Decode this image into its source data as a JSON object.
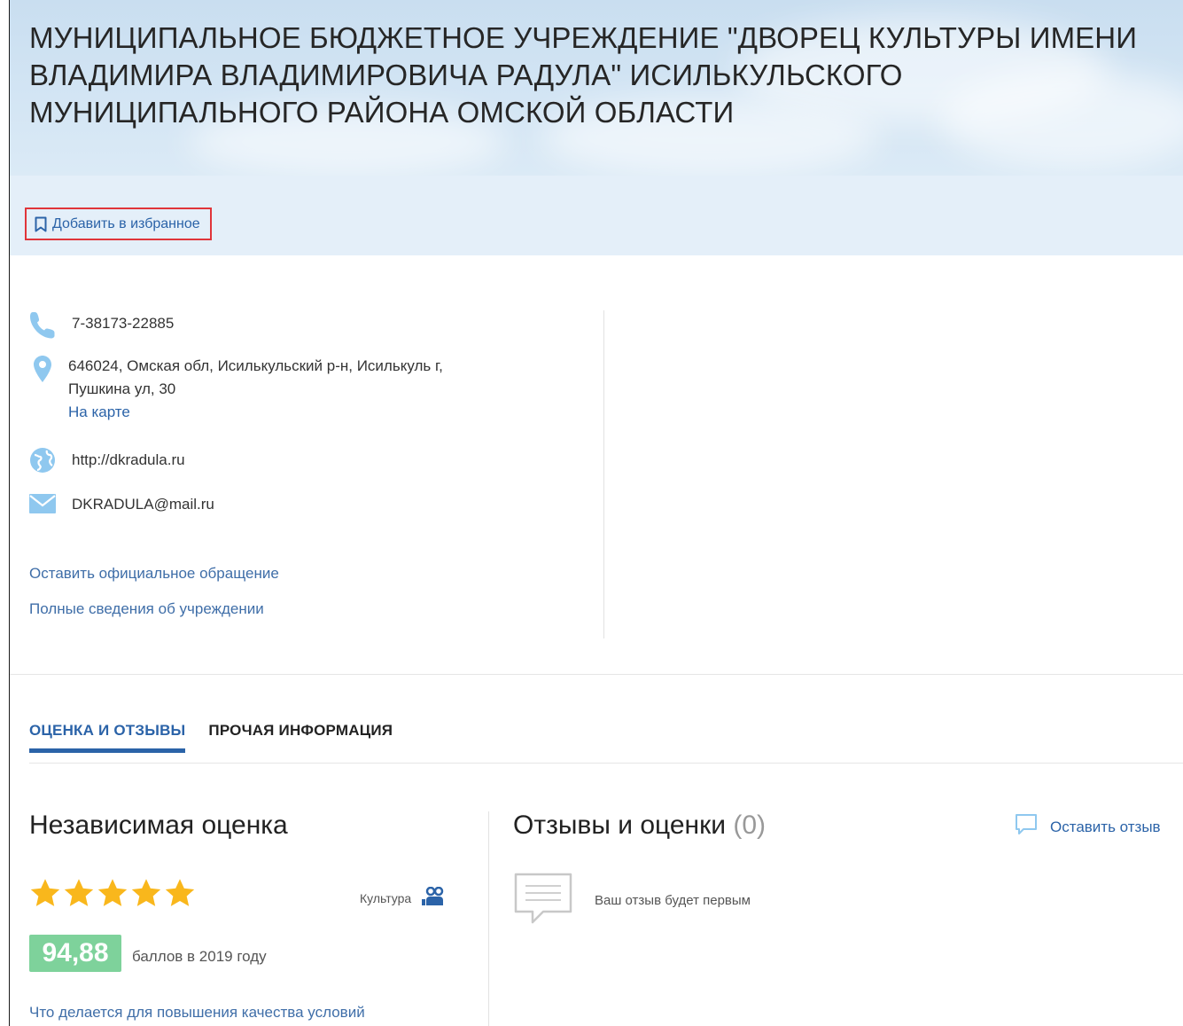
{
  "header": {
    "title": "МУНИЦИПАЛЬНОЕ БЮДЖЕТНОЕ УЧРЕЖДЕНИЕ \"ДВОРЕЦ КУЛЬТУРЫ ИМЕНИ ВЛАДИМИРА ВЛАДИМИРОВИЧА РАДУЛА\" ИСИЛЬКУЛЬСКОГО МУНИЦИПАЛЬНОГО РАЙОНА ОМСКОЙ ОБЛАСТИ",
    "favorite_label": "Добавить в избранное",
    "favorite_icon": "bookmark-icon",
    "highlight_color": "#e0353a"
  },
  "contacts": {
    "phone": "7-38173-22885",
    "address_line1": "646024, Омская обл, Исилькульский р-н, Исилькуль г,",
    "address_line2": "Пушкина ул, 30",
    "map_link": "На карте",
    "website": "http://dkradula.ru",
    "email": "DKRADULA@mail.ru",
    "appeal_link": "Оставить официальное обращение",
    "details_link": "Полные сведения об учреждении",
    "icon_color": "#8fc8ef"
  },
  "tabs": [
    {
      "label": "ОЦЕНКА И ОТЗЫВЫ",
      "active": true
    },
    {
      "label": "ПРОЧАЯ ИНФОРМАЦИЯ",
      "active": false
    }
  ],
  "rating": {
    "heading": "Независимая оценка",
    "stars": 5,
    "star_color": "#f9b71c",
    "category": "Культура",
    "score": "94,88",
    "score_text": "баллов в 2019 году",
    "score_color": "#7ed29b",
    "quality_link": "Что делается для повышения качества условий"
  },
  "reviews": {
    "heading": "Отзывы и оценки",
    "count": "(0)",
    "leave_label": "Оставить отзыв",
    "empty_text": "Ваш отзыв будет первым"
  },
  "colors": {
    "accent": "#2b63a8",
    "header_bg": "#d3e5f4"
  }
}
